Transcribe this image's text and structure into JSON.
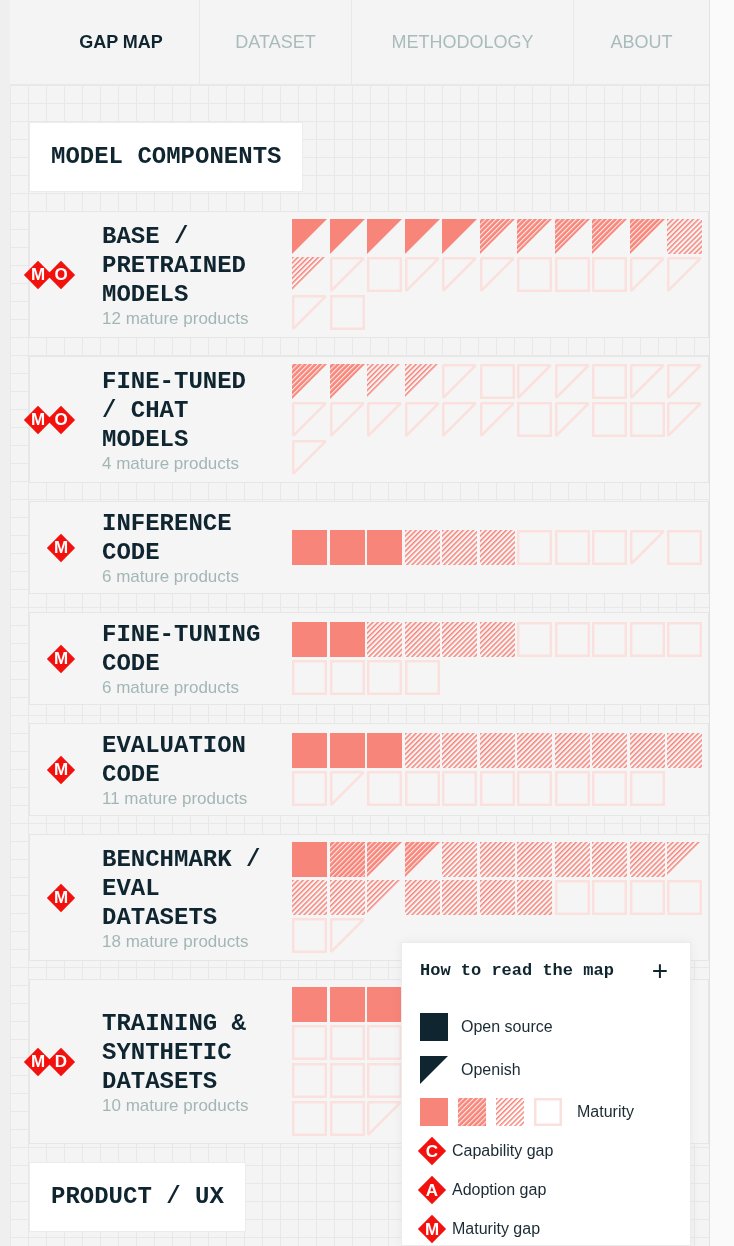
{
  "nav": {
    "tabs": [
      {
        "label": "GAP MAP",
        "selected": true
      },
      {
        "label": "DATASET",
        "selected": false
      },
      {
        "label": "METHODOLOGY",
        "selected": false
      },
      {
        "label": "ABOUT",
        "selected": false
      }
    ]
  },
  "sections": [
    {
      "title": "MODEL COMPONENTS",
      "products": [
        {
          "gaps": [
            "M",
            "O"
          ],
          "title": "BASE / PRETRAINED MODELS",
          "subtitle": "12 mature products",
          "tile_rows": [
            [
              {
                "kind": "triangle",
                "filled": true,
                "hatched": false
              },
              {
                "kind": "triangle",
                "filled": true,
                "hatched": false
              },
              {
                "kind": "triangle",
                "filled": true,
                "hatched": false
              },
              {
                "kind": "triangle",
                "filled": true,
                "hatched": false
              },
              {
                "kind": "triangle",
                "filled": true,
                "hatched": false
              },
              {
                "kind": "triangle",
                "filled": true,
                "hatched": true
              },
              {
                "kind": "triangle",
                "filled": true,
                "hatched": true
              },
              {
                "kind": "triangle",
                "filled": true,
                "hatched": true
              },
              {
                "kind": "triangle",
                "filled": true,
                "hatched": true
              },
              {
                "kind": "triangle",
                "filled": true,
                "hatched": true
              },
              {
                "kind": "square",
                "filled": false,
                "hatched": true
              }
            ],
            [
              {
                "kind": "triangle",
                "filled": false,
                "hatched": true
              },
              {
                "kind": "triangle",
                "filled": false,
                "hatched": false
              },
              {
                "kind": "square",
                "filled": false,
                "hatched": false
              },
              {
                "kind": "triangle",
                "filled": false,
                "hatched": false
              },
              {
                "kind": "triangle",
                "filled": false,
                "hatched": false
              },
              {
                "kind": "triangle",
                "filled": false,
                "hatched": false
              },
              {
                "kind": "square",
                "filled": false,
                "hatched": false
              },
              {
                "kind": "square",
                "filled": false,
                "hatched": false
              },
              {
                "kind": "square",
                "filled": false,
                "hatched": false
              },
              {
                "kind": "triangle",
                "filled": false,
                "hatched": false
              },
              {
                "kind": "triangle",
                "filled": false,
                "hatched": false
              }
            ],
            [
              {
                "kind": "triangle",
                "filled": false,
                "hatched": false
              },
              {
                "kind": "square",
                "filled": false,
                "hatched": false
              }
            ]
          ]
        },
        {
          "gaps": [
            "M",
            "O"
          ],
          "title": "FINE-TUNED / CHAT MODELS",
          "subtitle": "4 mature products",
          "tile_rows": [
            [
              {
                "kind": "triangle",
                "filled": true,
                "hatched": true
              },
              {
                "kind": "triangle",
                "filled": true,
                "hatched": true
              },
              {
                "kind": "triangle",
                "filled": false,
                "hatched": true
              },
              {
                "kind": "triangle",
                "filled": false,
                "hatched": true
              },
              {
                "kind": "triangle",
                "filled": false,
                "hatched": false
              },
              {
                "kind": "square",
                "filled": false,
                "hatched": false
              },
              {
                "kind": "triangle",
                "filled": false,
                "hatched": false
              },
              {
                "kind": "triangle",
                "filled": false,
                "hatched": false
              },
              {
                "kind": "square",
                "filled": false,
                "hatched": false
              },
              {
                "kind": "triangle",
                "filled": false,
                "hatched": false
              },
              {
                "kind": "triangle",
                "filled": false,
                "hatched": false
              }
            ],
            [
              {
                "kind": "triangle",
                "filled": false,
                "hatched": false
              },
              {
                "kind": "triangle",
                "filled": false,
                "hatched": false
              },
              {
                "kind": "triangle",
                "filled": false,
                "hatched": false
              },
              {
                "kind": "triangle",
                "filled": false,
                "hatched": false
              },
              {
                "kind": "triangle",
                "filled": false,
                "hatched": false
              },
              {
                "kind": "triangle",
                "filled": false,
                "hatched": false
              },
              {
                "kind": "square",
                "filled": false,
                "hatched": false
              },
              {
                "kind": "triangle",
                "filled": false,
                "hatched": false
              },
              {
                "kind": "square",
                "filled": false,
                "hatched": false
              },
              {
                "kind": "square",
                "filled": false,
                "hatched": false
              },
              {
                "kind": "triangle",
                "filled": false,
                "hatched": false
              }
            ],
            [
              {
                "kind": "triangle",
                "filled": false,
                "hatched": false
              }
            ]
          ]
        },
        {
          "gaps": [
            "M"
          ],
          "title": "INFERENCE CODE",
          "subtitle": "6 mature products",
          "tile_rows": [
            [
              {
                "kind": "square",
                "filled": true,
                "hatched": false
              },
              {
                "kind": "square",
                "filled": true,
                "hatched": false
              },
              {
                "kind": "square",
                "filled": true,
                "hatched": false
              },
              {
                "kind": "square",
                "filled": false,
                "hatched": true
              },
              {
                "kind": "square",
                "filled": false,
                "hatched": true
              },
              {
                "kind": "square",
                "filled": false,
                "hatched": true
              },
              {
                "kind": "square",
                "filled": false,
                "hatched": false
              },
              {
                "kind": "square",
                "filled": false,
                "hatched": false
              },
              {
                "kind": "square",
                "filled": false,
                "hatched": false
              },
              {
                "kind": "triangle",
                "filled": false,
                "hatched": false
              },
              {
                "kind": "square",
                "filled": false,
                "hatched": false
              }
            ]
          ]
        },
        {
          "gaps": [
            "M"
          ],
          "title": "FINE-TUNING CODE",
          "subtitle": "6 mature products",
          "tile_rows": [
            [
              {
                "kind": "square",
                "filled": true,
                "hatched": false
              },
              {
                "kind": "square",
                "filled": true,
                "hatched": false
              },
              {
                "kind": "square",
                "filled": false,
                "hatched": true
              },
              {
                "kind": "square",
                "filled": false,
                "hatched": true
              },
              {
                "kind": "square",
                "filled": false,
                "hatched": true
              },
              {
                "kind": "square",
                "filled": false,
                "hatched": true
              },
              {
                "kind": "square",
                "filled": false,
                "hatched": false
              },
              {
                "kind": "square",
                "filled": false,
                "hatched": false
              },
              {
                "kind": "square",
                "filled": false,
                "hatched": false
              },
              {
                "kind": "square",
                "filled": false,
                "hatched": false
              },
              {
                "kind": "square",
                "filled": false,
                "hatched": false
              }
            ],
            [
              {
                "kind": "square",
                "filled": false,
                "hatched": false
              },
              {
                "kind": "square",
                "filled": false,
                "hatched": false
              },
              {
                "kind": "square",
                "filled": false,
                "hatched": false
              },
              {
                "kind": "square",
                "filled": false,
                "hatched": false
              }
            ]
          ]
        },
        {
          "gaps": [
            "M"
          ],
          "title": "EVALUATION CODE",
          "subtitle": "11 mature products",
          "tile_rows": [
            [
              {
                "kind": "square",
                "filled": true,
                "hatched": false
              },
              {
                "kind": "square",
                "filled": true,
                "hatched": false
              },
              {
                "kind": "square",
                "filled": true,
                "hatched": false
              },
              {
                "kind": "square",
                "filled": false,
                "hatched": true
              },
              {
                "kind": "square",
                "filled": false,
                "hatched": true
              },
              {
                "kind": "square",
                "filled": false,
                "hatched": true
              },
              {
                "kind": "square",
                "filled": false,
                "hatched": true
              },
              {
                "kind": "square",
                "filled": false,
                "hatched": true
              },
              {
                "kind": "square",
                "filled": false,
                "hatched": true
              },
              {
                "kind": "square",
                "filled": false,
                "hatched": true
              },
              {
                "kind": "square",
                "filled": false,
                "hatched": true
              }
            ],
            [
              {
                "kind": "square",
                "filled": false,
                "hatched": false
              },
              {
                "kind": "triangle",
                "filled": false,
                "hatched": false
              },
              {
                "kind": "square",
                "filled": false,
                "hatched": false
              },
              {
                "kind": "square",
                "filled": false,
                "hatched": false
              },
              {
                "kind": "square",
                "filled": false,
                "hatched": false
              },
              {
                "kind": "square",
                "filled": false,
                "hatched": false
              },
              {
                "kind": "square",
                "filled": false,
                "hatched": false
              },
              {
                "kind": "square",
                "filled": false,
                "hatched": false
              },
              {
                "kind": "square",
                "filled": false,
                "hatched": false
              },
              {
                "kind": "square",
                "filled": false,
                "hatched": false
              }
            ]
          ]
        },
        {
          "gaps": [
            "M"
          ],
          "title": "BENCHMARK / EVAL DATASETS",
          "subtitle": "18 mature products",
          "tile_rows": [
            [
              {
                "kind": "square",
                "filled": true,
                "hatched": false
              },
              {
                "kind": "square",
                "filled": true,
                "hatched": true
              },
              {
                "kind": "triangle",
                "filled": true,
                "hatched": true
              },
              {
                "kind": "triangle",
                "filled": true,
                "hatched": true
              },
              {
                "kind": "square",
                "filled": false,
                "hatched": true
              },
              {
                "kind": "square",
                "filled": false,
                "hatched": true
              },
              {
                "kind": "square",
                "filled": false,
                "hatched": true
              },
              {
                "kind": "square",
                "filled": false,
                "hatched": true
              },
              {
                "kind": "square",
                "filled": false,
                "hatched": true
              },
              {
                "kind": "square",
                "filled": false,
                "hatched": true
              },
              {
                "kind": "triangle",
                "filled": false,
                "hatched": true
              }
            ],
            [
              {
                "kind": "square",
                "filled": false,
                "hatched": true
              },
              {
                "kind": "square",
                "filled": false,
                "hatched": true
              },
              {
                "kind": "triangle",
                "filled": false,
                "hatched": true
              },
              {
                "kind": "square",
                "filled": false,
                "hatched": true
              },
              {
                "kind": "square",
                "filled": false,
                "hatched": true
              },
              {
                "kind": "square",
                "filled": false,
                "hatched": true
              },
              {
                "kind": "square",
                "filled": false,
                "hatched": true
              },
              {
                "kind": "square",
                "filled": false,
                "hatched": false
              },
              {
                "kind": "square",
                "filled": false,
                "hatched": false
              },
              {
                "kind": "square",
                "filled": false,
                "hatched": false
              },
              {
                "kind": "square",
                "filled": false,
                "hatched": false
              }
            ],
            [
              {
                "kind": "square",
                "filled": false,
                "hatched": false
              },
              {
                "kind": "triangle",
                "filled": false,
                "hatched": false
              }
            ]
          ]
        },
        {
          "gaps": [
            "M",
            "D"
          ],
          "title": "TRAINING & SYNTHETIC DATASETS",
          "subtitle": "10 mature products",
          "tile_rows": [
            [
              {
                "kind": "square",
                "filled": true,
                "hatched": false
              },
              {
                "kind": "square",
                "filled": true,
                "hatched": false
              },
              {
                "kind": "square",
                "filled": true,
                "hatched": false
              }
            ],
            [
              {
                "kind": "square",
                "filled": false,
                "hatched": false
              },
              {
                "kind": "square",
                "filled": false,
                "hatched": false
              },
              {
                "kind": "square",
                "filled": false,
                "hatched": false
              }
            ],
            [
              {
                "kind": "square",
                "filled": false,
                "hatched": false
              },
              {
                "kind": "square",
                "filled": false,
                "hatched": false
              },
              {
                "kind": "square",
                "filled": false,
                "hatched": false
              }
            ],
            [
              {
                "kind": "square",
                "filled": false,
                "hatched": false
              },
              {
                "kind": "square",
                "filled": false,
                "hatched": false
              },
              {
                "kind": "triangle",
                "filled": false,
                "hatched": false
              }
            ]
          ]
        }
      ]
    },
    {
      "title": "PRODUCT / UX"
    }
  ],
  "legend": {
    "title": "How to read the map",
    "toggle": "+",
    "items": [
      {
        "kind": "square",
        "label": "Open source"
      },
      {
        "kind": "triangle",
        "label": "Openish"
      },
      {
        "kind": "maturity",
        "label": "Maturity",
        "swatches": [
          {
            "filled": true,
            "hatched": false
          },
          {
            "filled": true,
            "hatched": true
          },
          {
            "filled": false,
            "hatched": true
          },
          {
            "filled": false,
            "hatched": false
          }
        ]
      },
      {
        "kind": "gap",
        "letter": "C",
        "label": "Capability gap"
      },
      {
        "kind": "gap",
        "letter": "A",
        "label": "Adoption gap"
      },
      {
        "kind": "gap",
        "letter": "M",
        "label": "Maturity gap"
      }
    ]
  }
}
